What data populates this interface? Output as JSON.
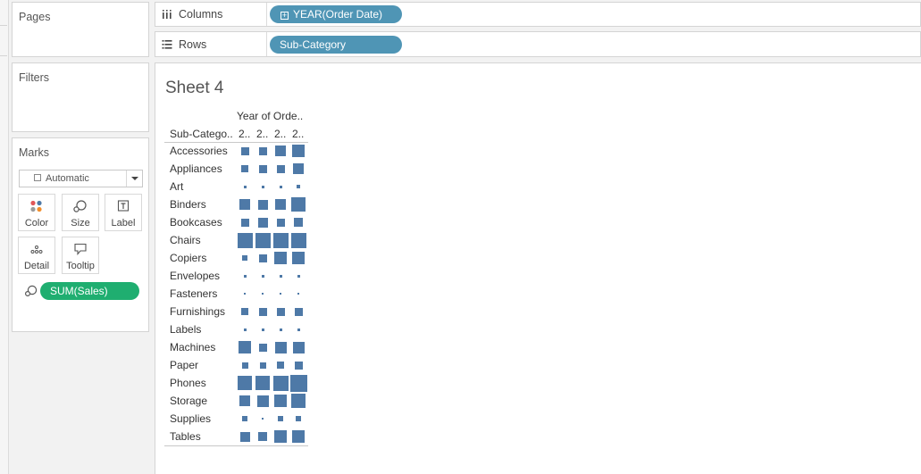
{
  "cards": {
    "pages_title": "Pages",
    "filters_title": "Filters",
    "marks_title": "Marks"
  },
  "marks": {
    "type_select": "Automatic",
    "buttons": {
      "color": "Color",
      "size": "Size",
      "label": "Label",
      "detail": "Detail",
      "tooltip": "Tooltip"
    },
    "size_pill": "SUM(Sales)"
  },
  "shelves": {
    "columns_label": "Columns",
    "columns_pill": "YEAR(Order Date)",
    "rows_label": "Rows",
    "rows_pill": "Sub-Category"
  },
  "sheet": {
    "title": "Sheet 4",
    "column_header_title": "Year of Orde..",
    "row_header_title": "Sub-Catego..",
    "year_headers": [
      "2..",
      "2..",
      "2..",
      "2.."
    ]
  },
  "chart_data": {
    "type": "table",
    "mark": "square",
    "size_encoding": "SUM(Sales)",
    "columns_field": "YEAR(Order Date)",
    "rows_field": "Sub-Category",
    "colors": {
      "mark": "#4e79a7"
    },
    "rows": [
      {
        "category": "Accessories",
        "size_rel": [
          0.5,
          0.55,
          0.7,
          0.85
        ]
      },
      {
        "category": "Appliances",
        "size_rel": [
          0.45,
          0.5,
          0.55,
          0.7
        ]
      },
      {
        "category": "Art",
        "size_rel": [
          0.2,
          0.2,
          0.2,
          0.25
        ]
      },
      {
        "category": "Binders",
        "size_rel": [
          0.7,
          0.65,
          0.7,
          0.92
        ]
      },
      {
        "category": "Bookcases",
        "size_rel": [
          0.5,
          0.65,
          0.5,
          0.6
        ]
      },
      {
        "category": "Chairs",
        "size_rel": [
          1.0,
          1.0,
          1.0,
          1.0
        ]
      },
      {
        "category": "Copiers",
        "size_rel": [
          0.35,
          0.55,
          0.8,
          0.85
        ]
      },
      {
        "category": "Envelopes",
        "size_rel": [
          0.18,
          0.2,
          0.2,
          0.2
        ]
      },
      {
        "category": "Fasteners",
        "size_rel": [
          0.08,
          0.08,
          0.08,
          0.08
        ]
      },
      {
        "category": "Furnishings",
        "size_rel": [
          0.45,
          0.5,
          0.5,
          0.55
        ]
      },
      {
        "category": "Labels",
        "size_rel": [
          0.15,
          0.15,
          0.15,
          0.15
        ]
      },
      {
        "category": "Machines",
        "size_rel": [
          0.85,
          0.5,
          0.75,
          0.75
        ]
      },
      {
        "category": "Paper",
        "size_rel": [
          0.4,
          0.4,
          0.45,
          0.5
        ]
      },
      {
        "category": "Phones",
        "size_rel": [
          0.95,
          0.92,
          1.0,
          1.1
        ]
      },
      {
        "category": "Storage",
        "size_rel": [
          0.7,
          0.75,
          0.8,
          0.92
        ]
      },
      {
        "category": "Supplies",
        "size_rel": [
          0.35,
          0.12,
          0.35,
          0.35
        ]
      },
      {
        "category": "Tables",
        "size_rel": [
          0.65,
          0.6,
          0.85,
          0.85
        ]
      }
    ]
  }
}
